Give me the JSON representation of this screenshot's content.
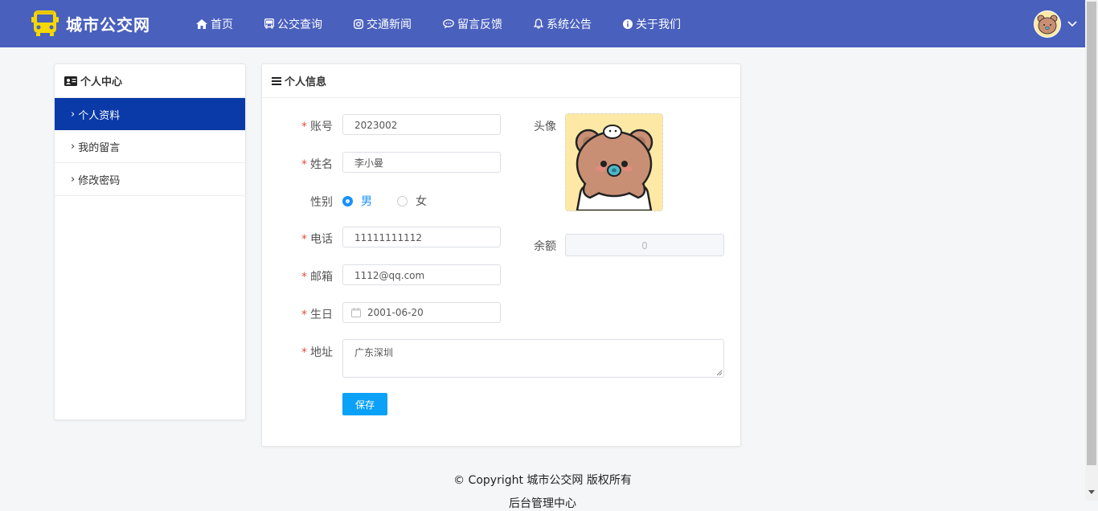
{
  "brand": {
    "title": "城市公交网",
    "color": "#4a60bd",
    "logo_icon": "bus-icon"
  },
  "nav": [
    {
      "label": "首页",
      "icon": "home-icon"
    },
    {
      "label": "公交查询",
      "icon": "bus-icon"
    },
    {
      "label": "交通新闻",
      "icon": "instagram-icon"
    },
    {
      "label": "留言反馈",
      "icon": "comment-icon"
    },
    {
      "label": "系统公告",
      "icon": "bell-icon"
    },
    {
      "label": "关于我们",
      "icon": "info-icon"
    }
  ],
  "sidebar": {
    "title": "个人中心",
    "items": [
      {
        "label": "个人资料",
        "active": true
      },
      {
        "label": "我的留言",
        "active": false
      },
      {
        "label": "修改密码",
        "active": false
      }
    ]
  },
  "panel": {
    "title": "个人信息"
  },
  "form": {
    "account_label": "账号",
    "account_value": "2023002",
    "name_label": "姓名",
    "name_value": "李小曼",
    "gender_label": "性别",
    "gender_male": "男",
    "gender_female": "女",
    "gender_selected": "男",
    "phone_label": "电话",
    "phone_value": "11111111112",
    "email_label": "邮箱",
    "email_value": "1112@qq.com",
    "birthday_label": "生日",
    "birthday_value": "2001-06-20",
    "address_label": "地址",
    "address_value": "广东深圳",
    "avatar_label": "头像",
    "balance_label": "余额",
    "balance_value": "0",
    "save_label": "保存"
  },
  "footer": {
    "copyright": "© Copyright 城市公交网 版权所有",
    "admin_link": "后台管理中心"
  },
  "colors": {
    "accent": "#0aa1f7",
    "active_sidebar": "#0a3aa8",
    "required": "#e74c3c"
  }
}
